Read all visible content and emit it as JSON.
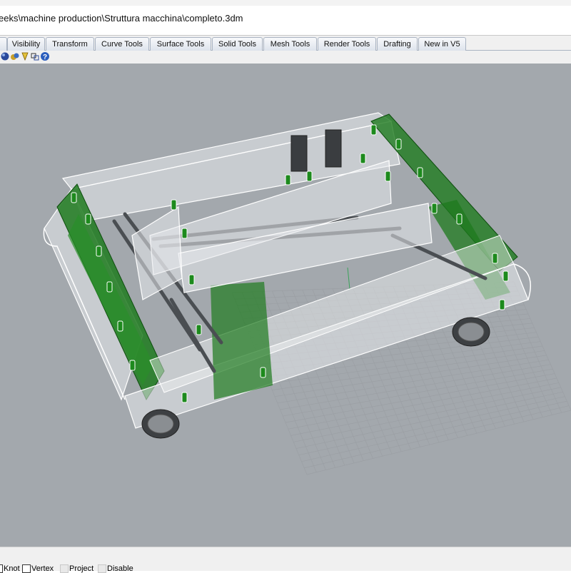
{
  "window": {
    "file_path": "eeks\\machine production\\Struttura macchina\\completo.3dm"
  },
  "toolbar_tabs": [
    {
      "label": "Visibility"
    },
    {
      "label": "Transform"
    },
    {
      "label": "Curve Tools"
    },
    {
      "label": "Surface Tools"
    },
    {
      "label": "Solid Tools"
    },
    {
      "label": "Mesh Tools"
    },
    {
      "label": "Render Tools"
    },
    {
      "label": "Drafting"
    },
    {
      "label": "New in V5"
    }
  ],
  "toolbar_icons": [
    "render-sphere-icon",
    "materials-icon",
    "light-icon",
    "render-setup-icon",
    "help-icon"
  ],
  "osnap": [
    {
      "label": "Knot",
      "checked": true
    },
    {
      "label": "Vertex",
      "checked": true
    },
    {
      "label": "Project",
      "checked": false
    },
    {
      "label": "Disable",
      "checked": false
    }
  ],
  "viewport": {
    "background_color": "#a3a8ad",
    "grid_color": "#9b9fa4",
    "panel_color": "#e8eaec",
    "bracket_color": "#1e7a1e"
  }
}
